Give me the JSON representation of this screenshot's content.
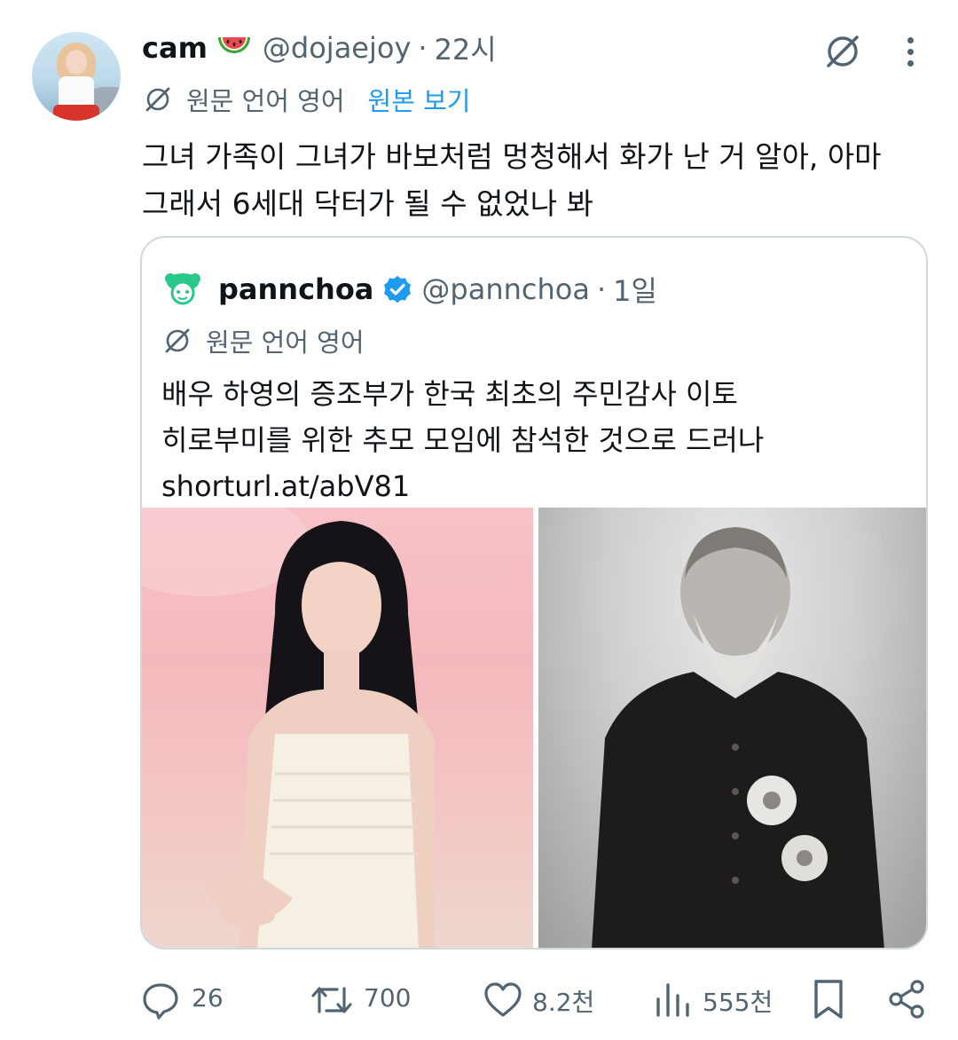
{
  "author": {
    "name": "cam",
    "emoji_icon": "watermelon-emoji",
    "handle": "@dojaejoy",
    "separator": "·",
    "time": "22시"
  },
  "translation": {
    "source_label": "원문 언어 영어",
    "show_original": "원본 보기"
  },
  "tweet": {
    "lines": [
      "그녀 가족이 그녀가 바보처럼 멍청해서 화가 난 거 알아, 아마",
      "그래서 6세대 닥터가 될 수 없었나 봐"
    ]
  },
  "quote": {
    "name": "pannchoa",
    "verified_icon": "verified-badge-icon",
    "handle": "@pannchoa",
    "separator": "·",
    "time": "1일",
    "source_label": "원문 언어 영어",
    "lines": [
      "배우 하영의 증조부가 한국 최초의 주민감사 이토",
      "히로부미를 위한 추모 모임에 참석한 것으로 드러나",
      "shorturl.at/abV81"
    ]
  },
  "actions": {
    "replies": "26",
    "reposts": "700",
    "likes": "8.2천",
    "views": "555천"
  },
  "colors": {
    "text": "#0f1419",
    "secondary": "#536471",
    "link": "#1d9bf0",
    "border": "#cfd9de",
    "verified": "#1d9bf0"
  }
}
